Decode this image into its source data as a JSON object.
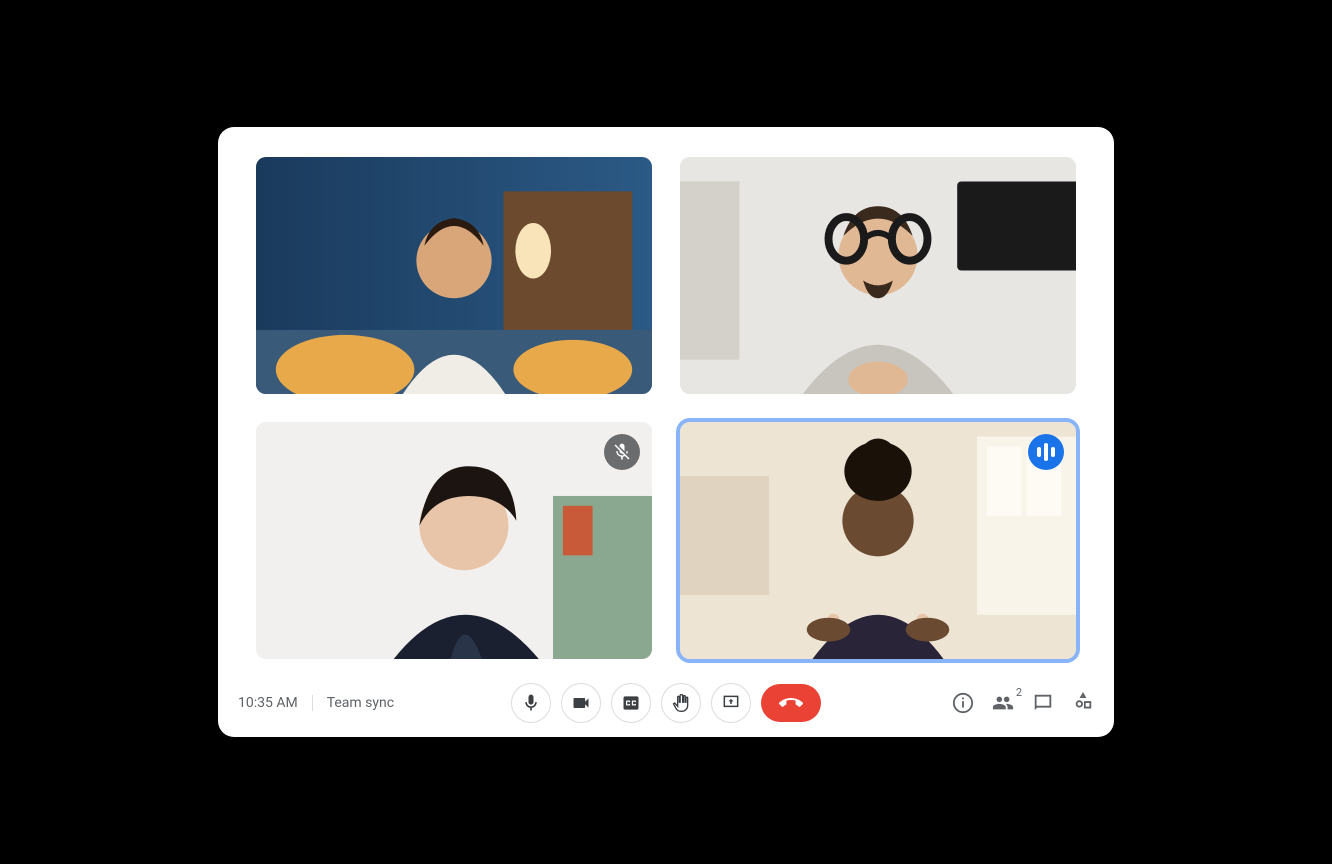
{
  "meeting": {
    "time": "10:35 AM",
    "title": "Team sync",
    "participant_count": "2"
  },
  "participants": [
    {
      "id": "p1",
      "muted": false,
      "speaking": false
    },
    {
      "id": "p2",
      "muted": false,
      "speaking": false
    },
    {
      "id": "p3",
      "muted": true,
      "speaking": false
    },
    {
      "id": "p4",
      "muted": false,
      "speaking": true
    }
  ],
  "controls": {
    "mic": "Microphone",
    "camera": "Camera",
    "captions": "Captions",
    "raise_hand": "Raise hand",
    "present": "Present screen",
    "hangup": "Leave call",
    "info": "Meeting details",
    "people": "People",
    "chat": "Chat",
    "activities": "Activities"
  }
}
